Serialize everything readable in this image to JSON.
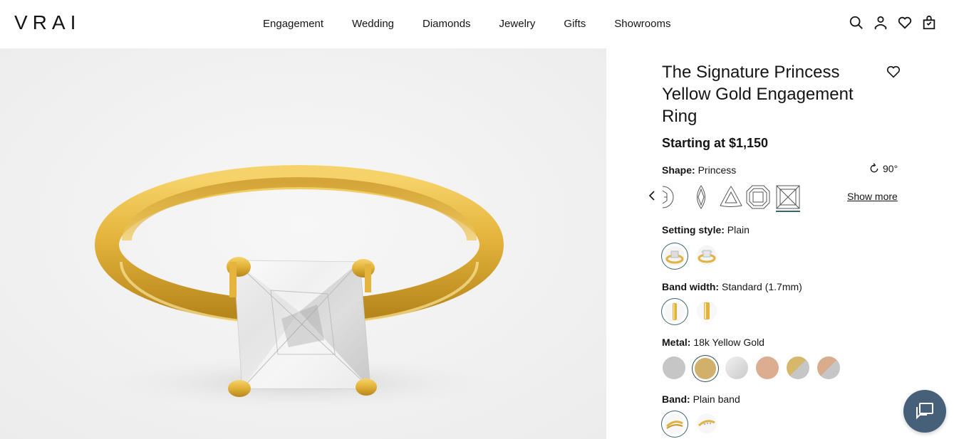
{
  "brand": {
    "logo": "VRAI"
  },
  "nav": {
    "items": [
      "Engagement",
      "Wedding",
      "Diamonds",
      "Jewelry",
      "Gifts",
      "Showrooms"
    ]
  },
  "header_icons": [
    "search-icon",
    "account-icon",
    "wishlist-heart-icon",
    "shopping-bag-icon"
  ],
  "product": {
    "title": "The Signature Princess Yellow Gold Engagement Ring",
    "price": "Starting at $1,150",
    "shape": {
      "label": "Shape:",
      "value": "Princess",
      "rotate": "90°",
      "show_more": "Show more",
      "options": [
        "round",
        "marquise",
        "trillion",
        "asscher",
        "princess"
      ],
      "selected": "princess"
    },
    "setting": {
      "label": "Setting style:",
      "value": "Plain",
      "options": [
        "plain",
        "hidden-halo"
      ]
    },
    "band_width": {
      "label": "Band width:",
      "value": "Standard (1.7mm)",
      "options": [
        "standard",
        "petite"
      ]
    },
    "metal": {
      "label": "Metal:",
      "value": "18k Yellow Gold",
      "options": [
        {
          "name": "platinum",
          "color": "#c6c6c6"
        },
        {
          "name": "yellow-gold",
          "color": "#d1b06b"
        },
        {
          "name": "white-gold",
          "color": "#e2e2e2"
        },
        {
          "name": "rose-gold",
          "color": "#dcad90"
        },
        {
          "name": "yellow-platinum",
          "color": "#d7b76a"
        },
        {
          "name": "rose-platinum",
          "color": "#d9ac8e"
        }
      ]
    },
    "band": {
      "label": "Band:",
      "value": "Plain band",
      "options": [
        "plain-band",
        "pave-band"
      ]
    }
  },
  "colors": {
    "accent": "#3a6470",
    "chat": "#46607a",
    "gold": "#e0b340",
    "image_bg": "#f1f1f1"
  }
}
